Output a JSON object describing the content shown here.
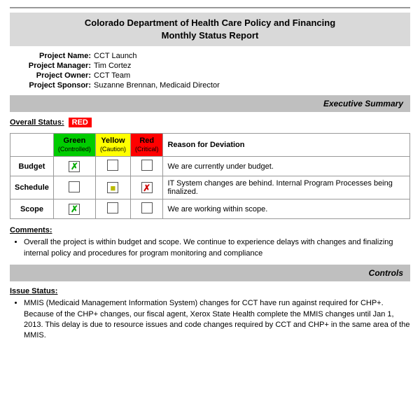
{
  "header": {
    "title_line1": "Colorado Department of Health Care Policy and Financing",
    "title_line2": "Monthly Status Report"
  },
  "project": {
    "name_label": "Project Name:",
    "name_value": "CCT Launch",
    "manager_label": "Project Manager:",
    "manager_value": "Tim Cortez",
    "owner_label": "Project Owner:",
    "owner_value": "CCT Team",
    "sponsor_label": "Project Sponsor:",
    "sponsor_value": "Suzanne Brennan, Medicaid Director"
  },
  "executive_summary": {
    "label": "Executive Summary"
  },
  "overall_status": {
    "label": "Overall Status:",
    "value": "RED"
  },
  "table": {
    "col_headers": {
      "green_label": "Green",
      "green_sub": "(Controlled)",
      "yellow_label": "Yellow",
      "yellow_sub": "(Caution)",
      "red_label": "Red",
      "red_sub": "(Critical)",
      "deviation_label": "Reason for Deviation"
    },
    "rows": [
      {
        "label": "Budget",
        "green": "check",
        "yellow": "empty",
        "red": "empty",
        "reason": "We are currently under budget."
      },
      {
        "label": "Schedule",
        "green": "empty",
        "yellow": "yellow",
        "red": "check",
        "reason": "IT System changes are behind. Internal Program Processes being finalized."
      },
      {
        "label": "Scope",
        "green": "check",
        "yellow": "empty",
        "red": "empty",
        "reason": "We are working within scope."
      }
    ]
  },
  "comments": {
    "label": "Comments:",
    "items": [
      "Overall the project is within budget and scope.  We continue to experience delays with changes and finalizing internal policy and procedures for program monitoring and compliance"
    ]
  },
  "controls": {
    "label": "Controls"
  },
  "issue_status": {
    "label": "Issue Status:",
    "items": [
      "MMIS (Medicaid Management Information System) changes for CCT have run against required for CHP+. Because of the CHP+ changes, our fiscal agent, Xerox State Health complete the MMIS changes until Jan 1, 2013.  This delay is due to resource issues and code changes required by CCT and CHP+ in the same area of the MMIS."
    ]
  }
}
